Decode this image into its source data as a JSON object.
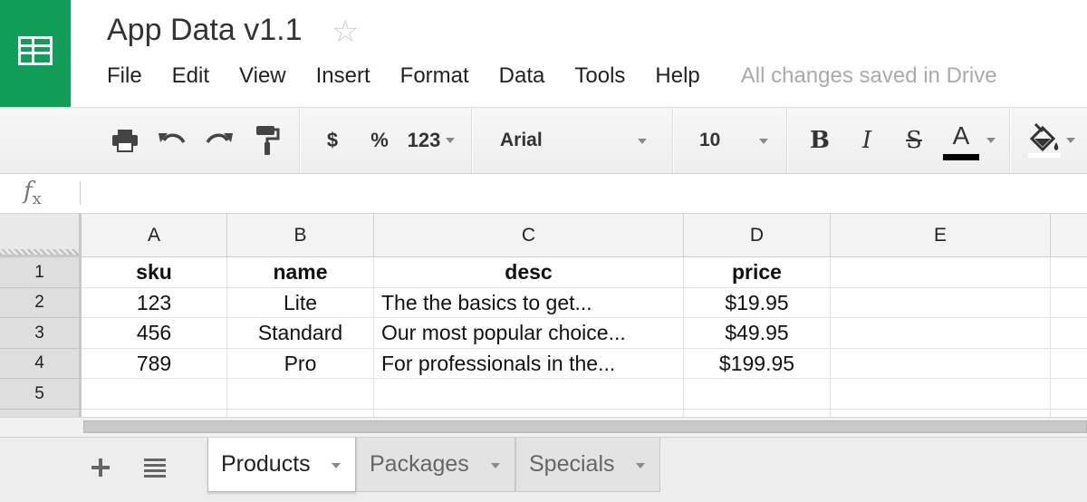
{
  "header": {
    "title": "App Data v1.1",
    "star_icon": "star-outline-icon",
    "menu": [
      "File",
      "Edit",
      "View",
      "Insert",
      "Format",
      "Data",
      "Tools",
      "Help"
    ],
    "save_status": "All changes saved in Drive"
  },
  "toolbar": {
    "currency_label": "$",
    "percent_label": "%",
    "number_format_label": "123",
    "font_name": "Arial",
    "font_size": "10",
    "bold_label": "B",
    "italic_label": "I",
    "strike_label": "S",
    "text_color_label": "A"
  },
  "formula_bar": {
    "fx_label": "f",
    "fx_sub": "x",
    "value": ""
  },
  "grid": {
    "columns": [
      "A",
      "B",
      "C",
      "D",
      "E"
    ],
    "rows": [
      "1",
      "2",
      "3",
      "4",
      "5"
    ],
    "cells": [
      [
        "sku",
        "name",
        "desc",
        "price",
        ""
      ],
      [
        "123",
        "Lite",
        "The the basics to get...",
        "$19.95",
        ""
      ],
      [
        "456",
        "Standard",
        "Our most popular choice...",
        "$49.95",
        ""
      ],
      [
        "789",
        "Pro",
        "For professionals in the...",
        "$199.95",
        ""
      ],
      [
        "",
        "",
        "",
        "",
        ""
      ]
    ]
  },
  "sheets": {
    "add_icon": "plus-icon",
    "list_icon": "list-icon",
    "tabs": [
      "Products",
      "Packages",
      "Specials"
    ],
    "active": "Products"
  },
  "colors": {
    "brand_green": "#0f9d58",
    "toolbar_bg": "#f1f1f1",
    "header_cell_bg": "#f3f3f3",
    "row_header_bg": "#dedede"
  }
}
